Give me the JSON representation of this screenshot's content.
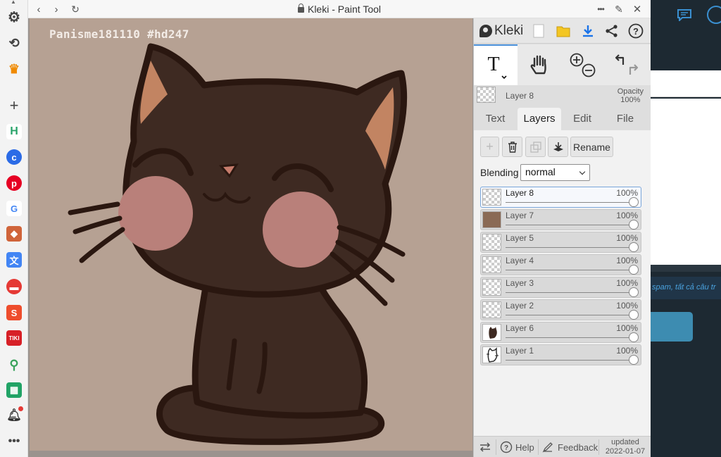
{
  "window": {
    "title": "Kleki - Paint Tool"
  },
  "canvas": {
    "watermark": "Panisme181110 #hd247"
  },
  "panel": {
    "logo": "Kleki",
    "top_icons": [
      "new-image-icon",
      "open-folder-icon",
      "download-icon",
      "share-icon",
      "help-icon"
    ],
    "tools": [
      "text-tool-icon",
      "hand-tool-icon",
      "zoom-in-icon",
      "zoom-out-icon",
      "undo-icon",
      "redo-icon"
    ],
    "current_layer": {
      "name": "Layer 8",
      "opacity_label": "Opacity",
      "opacity_value": "100%"
    },
    "tabs": [
      {
        "label": "Text",
        "active": false
      },
      {
        "label": "Layers",
        "active": true
      },
      {
        "label": "Edit",
        "active": false
      },
      {
        "label": "File",
        "active": false
      }
    ],
    "actions": {
      "rename_label": "Rename"
    },
    "blending": {
      "label": "Blending",
      "value": "normal"
    },
    "layers": [
      {
        "name": "Layer 8",
        "opacity": "100%",
        "selected": true,
        "opacity_fraction": 1.0
      },
      {
        "name": "Layer 7",
        "opacity": "100%",
        "selected": false,
        "opacity_fraction": 1.0
      },
      {
        "name": "Layer 5",
        "opacity": "100%",
        "selected": false,
        "opacity_fraction": 1.0
      },
      {
        "name": "Layer 4",
        "opacity": "100%",
        "selected": false,
        "opacity_fraction": 1.0
      },
      {
        "name": "Layer 3",
        "opacity": "100%",
        "selected": false,
        "opacity_fraction": 1.0
      },
      {
        "name": "Layer 2",
        "opacity": "100%",
        "selected": false,
        "opacity_fraction": 1.0
      },
      {
        "name": "Layer 6",
        "opacity": "100%",
        "selected": false,
        "opacity_fraction": 1.0
      },
      {
        "name": "Layer 1",
        "opacity": "100%",
        "selected": false,
        "opacity_fraction": 1.0
      }
    ],
    "footer": {
      "help_label": "Help",
      "feedback_label": "Feedback",
      "updated_label": "updated",
      "updated_date": "2022-01-07"
    }
  },
  "background_page": {
    "snippet": "spam, tất cả câu tr"
  },
  "colors": {
    "accent": "#4a90d9",
    "canvas_bg": "#b6a193",
    "cat_fill": "#3e2a22",
    "outline": "#2a1710",
    "blush": "#b9807a",
    "ear_inner": "#c28462"
  }
}
